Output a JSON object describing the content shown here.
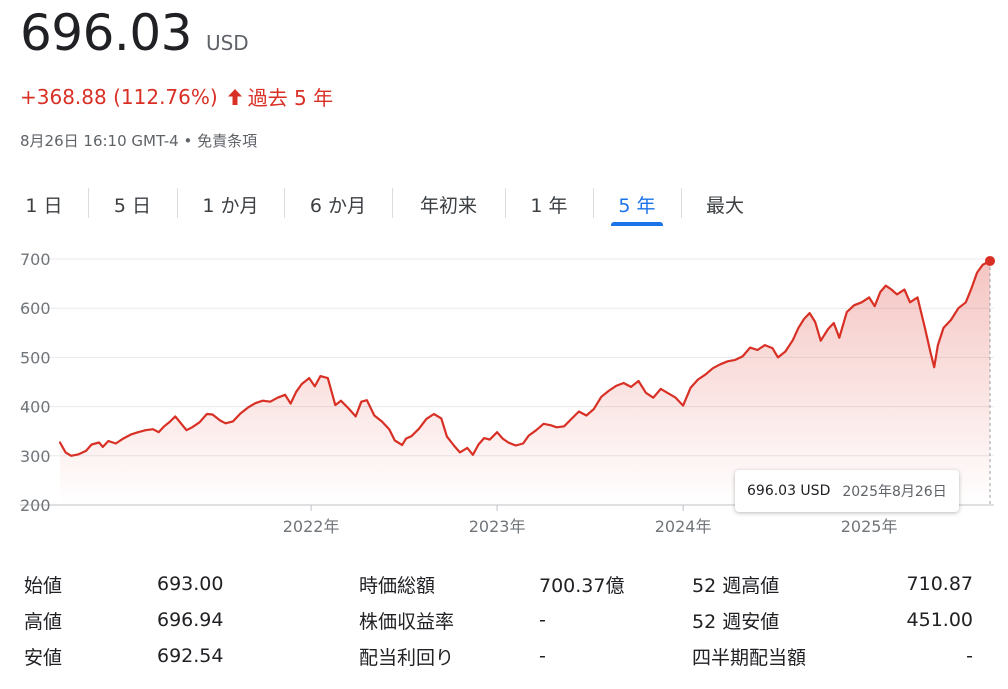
{
  "quote": {
    "price": "696.03",
    "currency": "USD",
    "change": "+368.88 (112.76%)",
    "period": "過去 5 年",
    "timestamp": "8月26日 16:10 GMT-4",
    "separator": "•",
    "disclaimer": "免責条項"
  },
  "colors": {
    "positive": "#d93025",
    "accent": "#1a73e8"
  },
  "tabs": [
    {
      "label": "1 日",
      "active": false
    },
    {
      "label": "5 日",
      "active": false
    },
    {
      "label": "1 か月",
      "active": false
    },
    {
      "label": "6 か月",
      "active": false
    },
    {
      "label": "年初来",
      "active": false
    },
    {
      "label": "1 年",
      "active": false
    },
    {
      "label": "5 年",
      "active": true
    },
    {
      "label": "最大",
      "active": false
    }
  ],
  "tooltip": {
    "value": "696.03 USD",
    "date": "2025年8月26日"
  },
  "chart_data": {
    "type": "area",
    "ylim": [
      200,
      700
    ],
    "yticks": [
      "700",
      "600",
      "500",
      "400",
      "300",
      "200"
    ],
    "xticks": [
      "2022年",
      "2023年",
      "2024年",
      "2025年"
    ],
    "xlim": [
      2020.65,
      2025.65
    ],
    "grid": true,
    "series": [
      {
        "values": [
          [
            2020.65,
            327
          ],
          [
            2020.68,
            307
          ],
          [
            2020.71,
            300
          ],
          [
            2020.75,
            303
          ],
          [
            2020.79,
            310
          ],
          [
            2020.82,
            323
          ],
          [
            2020.86,
            327
          ],
          [
            2020.88,
            318
          ],
          [
            2020.91,
            330
          ],
          [
            2020.95,
            325
          ],
          [
            2020.99,
            335
          ],
          [
            2021.03,
            343
          ],
          [
            2021.07,
            348
          ],
          [
            2021.11,
            352
          ],
          [
            2021.15,
            354
          ],
          [
            2021.18,
            348
          ],
          [
            2021.21,
            360
          ],
          [
            2021.24,
            369
          ],
          [
            2021.27,
            380
          ],
          [
            2021.3,
            366
          ],
          [
            2021.33,
            352
          ],
          [
            2021.36,
            358
          ],
          [
            2021.4,
            368
          ],
          [
            2021.44,
            385
          ],
          [
            2021.47,
            384
          ],
          [
            2021.51,
            372
          ],
          [
            2021.54,
            366
          ],
          [
            2021.58,
            370
          ],
          [
            2021.62,
            386
          ],
          [
            2021.66,
            398
          ],
          [
            2021.7,
            407
          ],
          [
            2021.74,
            412
          ],
          [
            2021.78,
            410
          ],
          [
            2021.82,
            418
          ],
          [
            2021.86,
            424
          ],
          [
            2021.89,
            406
          ],
          [
            2021.92,
            430
          ],
          [
            2021.95,
            446
          ],
          [
            2021.99,
            458
          ],
          [
            2022.02,
            441
          ],
          [
            2022.05,
            462
          ],
          [
            2022.09,
            458
          ],
          [
            2022.13,
            403
          ],
          [
            2022.16,
            412
          ],
          [
            2022.2,
            397
          ],
          [
            2022.24,
            380
          ],
          [
            2022.27,
            410
          ],
          [
            2022.3,
            413
          ],
          [
            2022.34,
            382
          ],
          [
            2022.38,
            370
          ],
          [
            2022.42,
            354
          ],
          [
            2022.45,
            331
          ],
          [
            2022.49,
            322
          ],
          [
            2022.51,
            335
          ],
          [
            2022.54,
            340
          ],
          [
            2022.58,
            355
          ],
          [
            2022.62,
            375
          ],
          [
            2022.66,
            385
          ],
          [
            2022.7,
            376
          ],
          [
            2022.73,
            339
          ],
          [
            2022.77,
            320
          ],
          [
            2022.8,
            307
          ],
          [
            2022.84,
            316
          ],
          [
            2022.87,
            302
          ],
          [
            2022.9,
            323
          ],
          [
            2022.93,
            336
          ],
          [
            2022.96,
            333
          ],
          [
            2023.0,
            348
          ],
          [
            2023.03,
            335
          ],
          [
            2023.06,
            327
          ],
          [
            2023.1,
            321
          ],
          [
            2023.14,
            325
          ],
          [
            2023.17,
            341
          ],
          [
            2023.21,
            352
          ],
          [
            2023.25,
            365
          ],
          [
            2023.29,
            362
          ],
          [
            2023.32,
            358
          ],
          [
            2023.36,
            360
          ],
          [
            2023.4,
            375
          ],
          [
            2023.44,
            390
          ],
          [
            2023.48,
            382
          ],
          [
            2023.52,
            395
          ],
          [
            2023.56,
            420
          ],
          [
            2023.6,
            432
          ],
          [
            2023.64,
            442
          ],
          [
            2023.68,
            448
          ],
          [
            2023.72,
            440
          ],
          [
            2023.76,
            452
          ],
          [
            2023.8,
            428
          ],
          [
            2023.84,
            418
          ],
          [
            2023.88,
            436
          ],
          [
            2023.92,
            427
          ],
          [
            2023.96,
            418
          ],
          [
            2024.0,
            402
          ],
          [
            2024.04,
            438
          ],
          [
            2024.08,
            455
          ],
          [
            2024.12,
            465
          ],
          [
            2024.16,
            478
          ],
          [
            2024.2,
            486
          ],
          [
            2024.24,
            492
          ],
          [
            2024.28,
            495
          ],
          [
            2024.32,
            502
          ],
          [
            2024.36,
            520
          ],
          [
            2024.4,
            515
          ],
          [
            2024.44,
            525
          ],
          [
            2024.48,
            519
          ],
          [
            2024.51,
            500
          ],
          [
            2024.55,
            512
          ],
          [
            2024.59,
            535
          ],
          [
            2024.62,
            560
          ],
          [
            2024.65,
            578
          ],
          [
            2024.68,
            590
          ],
          [
            2024.71,
            572
          ],
          [
            2024.74,
            534
          ],
          [
            2024.78,
            558
          ],
          [
            2024.81,
            570
          ],
          [
            2024.84,
            540
          ],
          [
            2024.88,
            592
          ],
          [
            2024.92,
            606
          ],
          [
            2024.96,
            612
          ],
          [
            2025.0,
            622
          ],
          [
            2025.03,
            604
          ],
          [
            2025.06,
            633
          ],
          [
            2025.09,
            646
          ],
          [
            2025.12,
            638
          ],
          [
            2025.15,
            628
          ],
          [
            2025.19,
            638
          ],
          [
            2025.22,
            612
          ],
          [
            2025.26,
            622
          ],
          [
            2025.3,
            560
          ],
          [
            2025.33,
            510
          ],
          [
            2025.35,
            480
          ],
          [
            2025.37,
            525
          ],
          [
            2025.4,
            560
          ],
          [
            2025.44,
            576
          ],
          [
            2025.48,
            600
          ],
          [
            2025.52,
            612
          ],
          [
            2025.55,
            640
          ],
          [
            2025.58,
            672
          ],
          [
            2025.61,
            688
          ],
          [
            2025.65,
            696
          ]
        ]
      }
    ]
  },
  "stats": [
    [
      {
        "label": "始値",
        "value": "693.00"
      },
      {
        "label": "時価総額",
        "value": "700.37億"
      },
      {
        "label": "52 週高値",
        "value": "710.87"
      }
    ],
    [
      {
        "label": "高値",
        "value": "696.94"
      },
      {
        "label": "株価収益率",
        "value": "-"
      },
      {
        "label": "52 週安値",
        "value": "451.00"
      }
    ],
    [
      {
        "label": "安値",
        "value": "692.54"
      },
      {
        "label": "配当利回り",
        "value": "-"
      },
      {
        "label": "四半期配当額",
        "value": "-"
      }
    ]
  ]
}
